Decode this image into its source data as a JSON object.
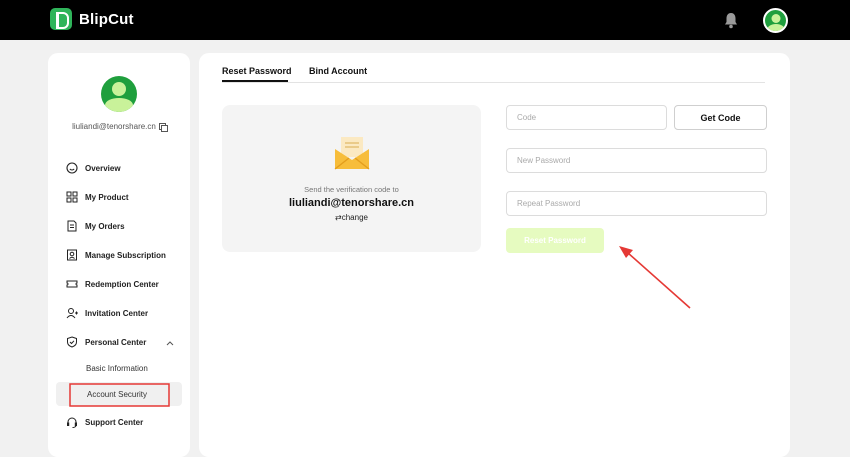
{
  "app": {
    "title": "BlipCut"
  },
  "colors": {
    "brand": "#2fb45a",
    "accent_light": "#e6fbc0",
    "annotation": "#e53935"
  },
  "header": {
    "bell_icon": "bell-icon",
    "avatar_icon": "user-avatar-icon"
  },
  "profile": {
    "email": "liuliandi@tenorshare.cn"
  },
  "sidebar": {
    "items": [
      {
        "label": "Overview",
        "icon": "smile-icon"
      },
      {
        "label": "My Product",
        "icon": "grid-icon"
      },
      {
        "label": "My Orders",
        "icon": "document-icon"
      },
      {
        "label": "Manage Subscription",
        "icon": "subscription-icon"
      },
      {
        "label": "Redemption Center",
        "icon": "ticket-icon"
      },
      {
        "label": "Invitation Center",
        "icon": "invite-user-icon"
      },
      {
        "label": "Personal Center",
        "icon": "shield-icon"
      },
      {
        "label": "Support Center",
        "icon": "headset-icon"
      }
    ],
    "sub_items": [
      {
        "label": "Basic Information"
      },
      {
        "label": "Account Security",
        "active": true
      }
    ]
  },
  "tabs": [
    {
      "label": "Reset Password",
      "active": true
    },
    {
      "label": "Bind Account",
      "active": false
    }
  ],
  "verify": {
    "message": "Send the verification code to",
    "email": "liuliandi@tenorshare.cn",
    "change_label": "⇄change"
  },
  "form": {
    "code_placeholder": "Code",
    "get_code_label": "Get Code",
    "new_password_placeholder": "New Password",
    "repeat_password_placeholder": "Repeat Password",
    "reset_label": "Reset Password"
  }
}
